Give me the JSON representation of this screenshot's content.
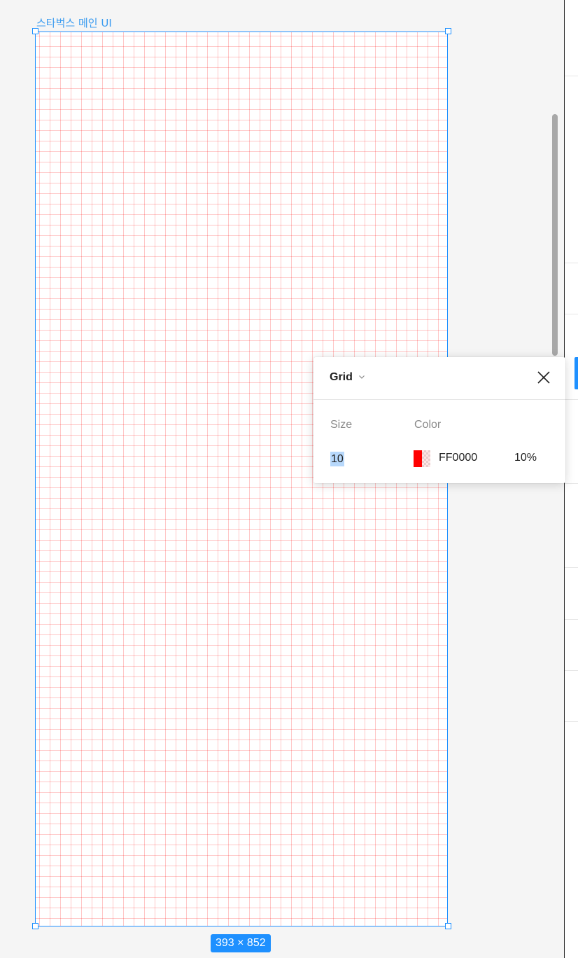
{
  "frame": {
    "name": "스타벅스 메인 UI",
    "dimensions": "393 × 852"
  },
  "grid_popover": {
    "title": "Grid",
    "size_label": "Size",
    "color_label": "Color",
    "size_value": "10",
    "color_hex": "FF0000",
    "opacity": "10%"
  },
  "icons": {
    "dropdown": "chevron-down-icon",
    "close": "close-icon"
  },
  "colors": {
    "selection": "#1e90ff",
    "grid_color": "#ff0000",
    "canvas": "#f5f5f5"
  }
}
